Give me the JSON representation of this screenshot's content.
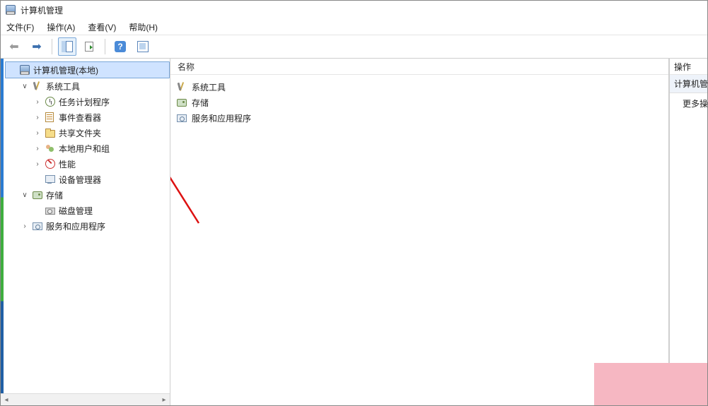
{
  "window": {
    "title": "计算机管理"
  },
  "menu": {
    "file": "文件(F)",
    "action": "操作(A)",
    "view": "查看(V)",
    "help": "帮助(H)"
  },
  "toolbar": {
    "back_enabled": false,
    "forward_enabled": true
  },
  "tree": {
    "root": {
      "label": "计算机管理(本地)",
      "selected": true,
      "children": [
        {
          "key": "system_tools",
          "label": "系统工具",
          "icon": "tools",
          "expanded": true,
          "children": [
            {
              "key": "task_scheduler",
              "label": "任务计划程序",
              "icon": "clock",
              "expandable": true
            },
            {
              "key": "event_viewer",
              "label": "事件查看器",
              "icon": "event",
              "expandable": true
            },
            {
              "key": "shared_folders",
              "label": "共享文件夹",
              "icon": "share",
              "expandable": true
            },
            {
              "key": "local_users",
              "label": "本地用户和组",
              "icon": "users",
              "expandable": true,
              "annotated": true
            },
            {
              "key": "performance",
              "label": "性能",
              "icon": "perf",
              "expandable": true
            },
            {
              "key": "device_manager",
              "label": "设备管理器",
              "icon": "device",
              "expandable": false
            }
          ]
        },
        {
          "key": "storage",
          "label": "存储",
          "icon": "storage",
          "expanded": true,
          "children": [
            {
              "key": "disk_mgmt",
              "label": "磁盘管理",
              "icon": "disk",
              "expandable": false
            }
          ]
        },
        {
          "key": "services_apps",
          "label": "服务和应用程序",
          "icon": "services",
          "expanded": false,
          "expandable": true
        }
      ]
    }
  },
  "list": {
    "header": "名称",
    "items": [
      {
        "label": "系统工具",
        "icon": "tools"
      },
      {
        "label": "存储",
        "icon": "storage"
      },
      {
        "label": "服务和应用程序",
        "icon": "services"
      }
    ]
  },
  "actions": {
    "header": "操作",
    "section_title": "计算机管理(本地)",
    "more": "更多操作"
  }
}
